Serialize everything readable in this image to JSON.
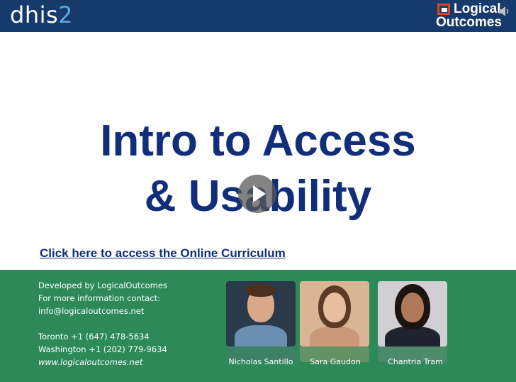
{
  "header": {
    "logo_main": "dhis",
    "logo_accent": "2",
    "partner_logo_line1": "Logical",
    "partner_logo_line2": "Outcomes",
    "colors": {
      "bar": "#163a6b",
      "accent": "#5fa7e0"
    }
  },
  "slide": {
    "title_line1": "Intro to Access",
    "title_line2": "& Usability",
    "link_text": "Click here to access the Online Curriculum",
    "title_color": "#102e7a"
  },
  "footer": {
    "developed_by": "Developed by LogicalOutcomes",
    "contact_label": "For more information contact:",
    "email": "info@logicaloutcomes.net",
    "toronto": "Toronto +1 (647) 478-5634",
    "washington": "Washington +1 (202) 779-9634",
    "website": "www.logicaloutcomes.net",
    "color": "#2d8a58"
  },
  "people": [
    {
      "name": "Nicholas Santillo"
    },
    {
      "name": "Sara Gaudon"
    },
    {
      "name": "Chantria Tram"
    }
  ],
  "icons": {
    "play": "play-icon",
    "volume": "speaker-icon"
  }
}
